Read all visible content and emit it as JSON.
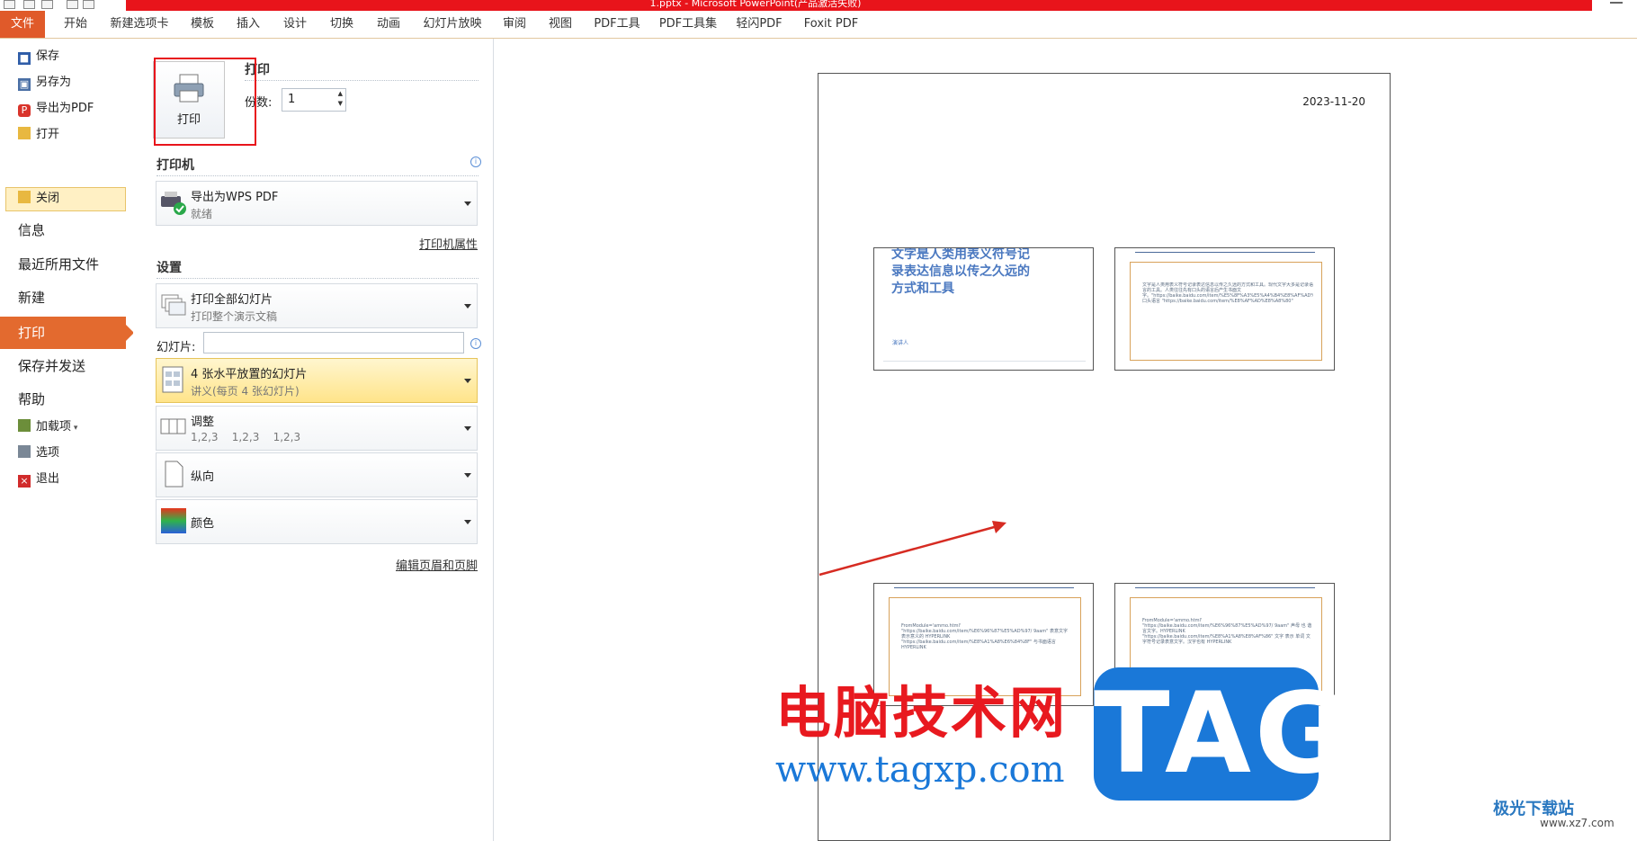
{
  "window": {
    "title": "1.pptx - Microsoft PowerPoint(产品激活失败)"
  },
  "ribbon": {
    "tabs": [
      "文件",
      "开始",
      "新建选项卡",
      "模板",
      "插入",
      "设计",
      "切换",
      "动画",
      "幻灯片放映",
      "审阅",
      "视图",
      "PDF工具",
      "PDF工具集",
      "轻闪PDF",
      "Foxit PDF"
    ]
  },
  "nav": {
    "save": "保存",
    "save_as": "另存为",
    "export_pdf": "导出为PDF",
    "open": "打开",
    "close": "关闭",
    "info": "信息",
    "recent": "最近所用文件",
    "new": "新建",
    "print": "打印",
    "save_send": "保存并发送",
    "help": "帮助",
    "addins": "加载项",
    "options": "选项",
    "exit": "退出"
  },
  "print_section": {
    "title": "打印",
    "button_label": "打印",
    "copies_label": "份数:",
    "copies_value": "1"
  },
  "printer": {
    "section_title": "打印机",
    "name": "导出为WPS PDF",
    "status": "就绪",
    "properties_link": "打印机属性"
  },
  "settings": {
    "section_title": "设置",
    "range_main": "打印全部幻灯片",
    "range_sub": "打印整个演示文稿",
    "slides_label": "幻灯片:",
    "slides_value": "",
    "layout_main": "4 张水平放置的幻灯片",
    "layout_sub": "讲义(每页 4 张幻灯片)",
    "collate_main": "调整",
    "collate_sub": "1,2,3    1,2,3    1,2,3",
    "orientation": "纵向",
    "color": "颜色",
    "header_footer_link": "编辑页眉和页脚"
  },
  "preview": {
    "date": "2023-11-20",
    "slide1_title": "文字是人类用表义符号记录表达信息以传之久远的方式和工具",
    "slide1_presenter": "演讲人",
    "slide2_text": "文字是人类用表义符号记录表达信息以传之久远的方式和工具。现代文字大多是记录语言的工具。人类往往先有口头的语言后产生书面文字。\"https://baike.baidu.com/item/%E5%8F%A3%E5%A4%B4%E8%AF%AD%E8%A8%80\" 口头语言 \"https://baike.baidu.com/item/%E8%AF%AD%E8%A8%80\"",
    "slide3_text": "FromModule='ammo.html' \"https://baike.baidu.com/item/%E6%96%87%E5%AD%97/ 9aam\" 表意文字 表示意义的 HYPERLINK \"https://baike.baidu.com/item/%E8%A1%A8%E6%84%8F\" 与书面语言 HYPERLINK",
    "slide4_text": "FromModule='ammo.html' \"https://baike.baidu.com/item/%E6%96%87%E5%AD%97/ 9aam\" 声母 也 谐言文字。HYPERLINK \"https://baike.baidu.com/item/%E8%A1%A8%E8%AF%86\" 文字 表示 单词 文字符号记录表意文字。汉字也有 HYPERLINK"
  },
  "watermark": {
    "cn": "电脑技术网",
    "url": "www.tagxp.com",
    "tag": "TAG",
    "jiguang": "极光下载站",
    "jiguang_url": "www.xz7.com"
  },
  "colors": {
    "file_tab": "#e05a2a",
    "nav_selected": "#e36a2f",
    "title_bar": "#e8141b",
    "highlight_box": "#e8141b",
    "layout_selected": "#ffe48a"
  }
}
